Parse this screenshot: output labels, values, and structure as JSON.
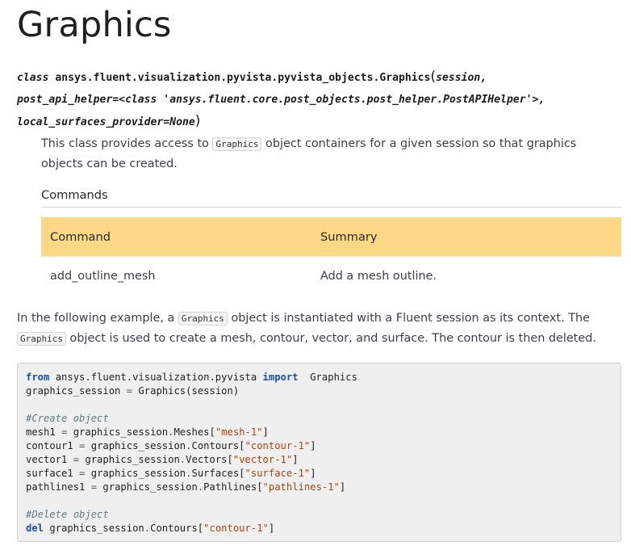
{
  "title": "Graphics",
  "signature": {
    "keyword": "class",
    "module_path": "ansys.fluent.visualization.pyvista.pyvista_objects.",
    "class_name": "Graphics",
    "open_paren": "(",
    "param1": "session,",
    "param2": "post_api_helper=<class 'ansys.fluent.core.post_objects.post_helper.PostAPIHelper'>,",
    "param3": "local_surfaces_provider=None",
    "close_paren": ")"
  },
  "description": {
    "before": "This class provides access to ",
    "code": "Graphics",
    "after": " object containers for a given session so that graphics objects can be created."
  },
  "commands": {
    "heading": "Commands",
    "headers": [
      "Command",
      "Summary"
    ],
    "rows": [
      {
        "command": "add_outline_mesh",
        "summary": "Add a mesh outline."
      }
    ]
  },
  "example_text": {
    "part1": "In the following example, a ",
    "code1": "Graphics",
    "part2": " object is instantiated with a Fluent session as its context. The ",
    "code2": "Graphics",
    "part3": " object is used to create a mesh, contour, vector, and surface. The contour is then deleted."
  },
  "code": {
    "l1_kw1": "from",
    "l1_mod": " ansys.fluent.visualization.pyvista ",
    "l1_kw2": "import",
    "l1_name": "  Graphics",
    "l2_a": "graphics_session ",
    "l2_eq": "=",
    "l2_b": " Graphics(session)",
    "comment1": "#Create object",
    "l4_a": "mesh1 ",
    "l4_b": " graphics_session",
    "l4_c": "Meshes[",
    "l4_s": "\"mesh-1\"",
    "l4_d": "]",
    "l5_a": "contour1 ",
    "l5_b": " graphics_session",
    "l5_c": "Contours[",
    "l5_s": "\"contour-1\"",
    "l5_d": "]",
    "l6_a": "vector1 ",
    "l6_b": " graphics_session",
    "l6_c": "Vectors[",
    "l6_s": "\"vector-1\"",
    "l6_d": "]",
    "l7_a": "surface1 ",
    "l7_b": " graphics_session",
    "l7_c": "Surfaces[",
    "l7_s": "\"surface-1\"",
    "l7_d": "]",
    "l8_a": "pathlines1 ",
    "l8_b": " graphics_session",
    "l8_c": "Pathlines[",
    "l8_s": "\"pathlines-1\"",
    "l8_d": "]",
    "comment2": "#Delete object",
    "l10_kw": "del",
    "l10_a": " graphics_session",
    "l10_b": "Contours[",
    "l10_s": "\"contour-1\"",
    "l10_c": "]",
    "eq": "=",
    "dot": "."
  },
  "colors": {
    "table_header": "#fcd785",
    "code_keyword": "#1c4ea8",
    "code_string": "#a84410",
    "code_comment": "#5e7d87"
  }
}
